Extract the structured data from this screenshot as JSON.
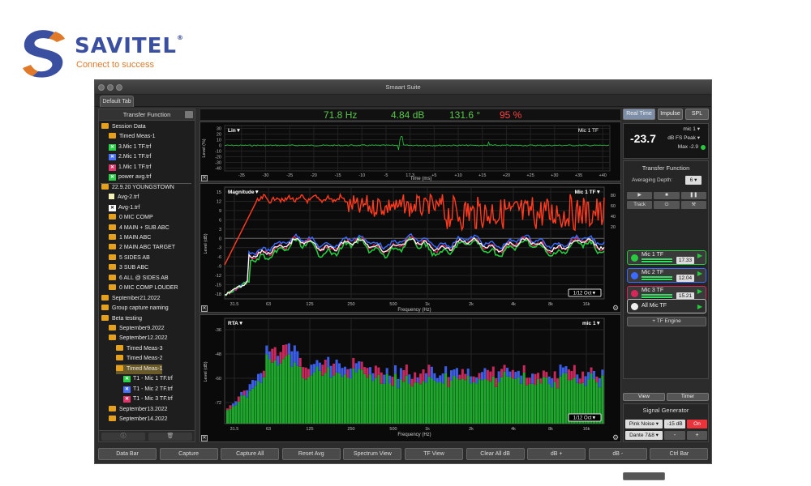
{
  "brand": {
    "name": "SAVITEL",
    "tagline": "Connect to success",
    "colors": {
      "blue": "#3b4fa0",
      "orange": "#e07a2a"
    }
  },
  "window": {
    "title": "Smaart Suite",
    "tab": "Default Tab"
  },
  "sidebar": {
    "header": "Transfer Function",
    "items": [
      {
        "label": "Session Data",
        "icon": "folder"
      },
      {
        "label": "Timed Meas-1",
        "icon": "folder"
      },
      {
        "label": "3.Mic 1 TF.trf",
        "icon": "x-green"
      },
      {
        "label": "2.Mic 1 TF.trf",
        "icon": "x-blue"
      },
      {
        "label": "1.Mic 1 TF.trf",
        "icon": "x-red"
      },
      {
        "label": "power avg.trf",
        "icon": "x-green"
      },
      {
        "label": "22.9.20 YOUNGSTOWN",
        "icon": "folder"
      },
      {
        "label": "Avg-2.trf",
        "icon": "doc"
      },
      {
        "label": "Avg-1.trf",
        "icon": "x-white"
      },
      {
        "label": "0 MIC COMP",
        "icon": "folder"
      },
      {
        "label": "4 MAIN + SUB ABC",
        "icon": "folder"
      },
      {
        "label": "1 MAIN ABC",
        "icon": "folder"
      },
      {
        "label": "2 MAIN ABC TARGET",
        "icon": "folder"
      },
      {
        "label": "5 SIDES AB",
        "icon": "folder"
      },
      {
        "label": "3 SUB ABC",
        "icon": "folder"
      },
      {
        "label": "6 ALL @ SIDES AB",
        "icon": "folder"
      },
      {
        "label": "0 MIC COMP LOUDER",
        "icon": "folder"
      },
      {
        "label": "September21.2022",
        "icon": "folder"
      },
      {
        "label": "Group capture naming",
        "icon": "folder"
      },
      {
        "label": "Beta testing",
        "icon": "folder"
      },
      {
        "label": "September9.2022",
        "icon": "folder"
      },
      {
        "label": "September12.2022",
        "icon": "folder"
      },
      {
        "label": "Timed Meas-3",
        "icon": "folder"
      },
      {
        "label": "Timed Meas-2",
        "icon": "folder"
      },
      {
        "label": "Timed Meas-1",
        "icon": "folder"
      },
      {
        "label": "T1 - Mic 1 TF.trf",
        "icon": "x-green"
      },
      {
        "label": "T1 - Mic 2 TF.trf",
        "icon": "x-blue"
      },
      {
        "label": "T1 - Mic 3 TF.trf",
        "icon": "x-red"
      },
      {
        "label": "September13.2022",
        "icon": "folder"
      },
      {
        "label": "September14.2022",
        "icon": "folder"
      }
    ]
  },
  "readout": {
    "freq": "71.8 Hz",
    "level": "4.84 dB",
    "phase": "131.6 °",
    "coherence": "95 %"
  },
  "impulse": {
    "label": "Lin▼",
    "channel": "Mic 1 TF",
    "ylabel": "Level (%)",
    "xlabel": "Time (ms)",
    "yticks": [
      "30",
      "20",
      "10",
      "0",
      "-10",
      "-20",
      "-30",
      "-40"
    ],
    "xticks": [
      "-35",
      "-30",
      "-25",
      "-20",
      "-15",
      "-10",
      "-5",
      "17.3",
      "+5",
      "+10",
      "+15",
      "+20",
      "+25",
      "+30",
      "+35",
      "+40"
    ]
  },
  "magnitude": {
    "label": "Magnitude▼",
    "channel": "Mic 1 TF▼",
    "ylabel": "Level (dB)",
    "xlabel": "Frequency (Hz)",
    "smoothing": "1/12 Oct▼",
    "yticks": [
      "15",
      "12",
      "9",
      "6",
      "3",
      "0",
      "-3",
      "-6",
      "-9",
      "-12",
      "-15",
      "-18"
    ],
    "y2ticks": [
      "80",
      "60",
      "40",
      "20"
    ],
    "xticks": [
      "31.5",
      "63",
      "125",
      "250",
      "500",
      "1k",
      "2k",
      "4k",
      "8k",
      "16k"
    ]
  },
  "rta": {
    "label": "RTA▼",
    "channel": "mic 1▼",
    "ylabel": "Level (dB)",
    "xlabel": "Frequency (Hz)",
    "smoothing": "1/12 Oct▼",
    "yticks": [
      "-36",
      "-48",
      "-60",
      "-72"
    ],
    "xticks": [
      "31.5",
      "63",
      "125",
      "250",
      "500",
      "1k",
      "2k",
      "4k",
      "8k",
      "16k"
    ]
  },
  "right_panel": {
    "modes": [
      "Real Time",
      "Impulse",
      "SPL"
    ],
    "meter": {
      "value": "-23.7",
      "channel": "mic 1",
      "unit": "dB FS Peak",
      "max": "Max -2.9"
    },
    "tf_title": "Transfer Function",
    "avg_label": "Averaging Depth:",
    "avg_value": "6",
    "track": "Track",
    "tf_rows": [
      {
        "name": "Mic 1 TF",
        "value": "17.33",
        "color": "#27c93f"
      },
      {
        "name": "Mic 2 TF",
        "value": "12.04",
        "color": "#3b6cff"
      },
      {
        "name": "Mic 3 TF",
        "value": "15.21",
        "color": "#d6275a"
      }
    ],
    "all_tf": "All Mic TF",
    "engine": "+ TF Engine",
    "view": "View",
    "timer": "Timer",
    "siggen_title": "Signal Generator",
    "sig_type": "Pink Noise",
    "sig_level": "-15 dB",
    "sig_on": "On",
    "sig_out": "Dante 7&8",
    "minus": "-",
    "plus": "+"
  },
  "bottom_buttons": [
    "Data Bar",
    "Capture",
    "Capture All",
    "Reset Avg",
    "Spectrum View",
    "TF View",
    "Clear All dB",
    "dB +",
    "dB -",
    "Ctrl Bar"
  ]
}
